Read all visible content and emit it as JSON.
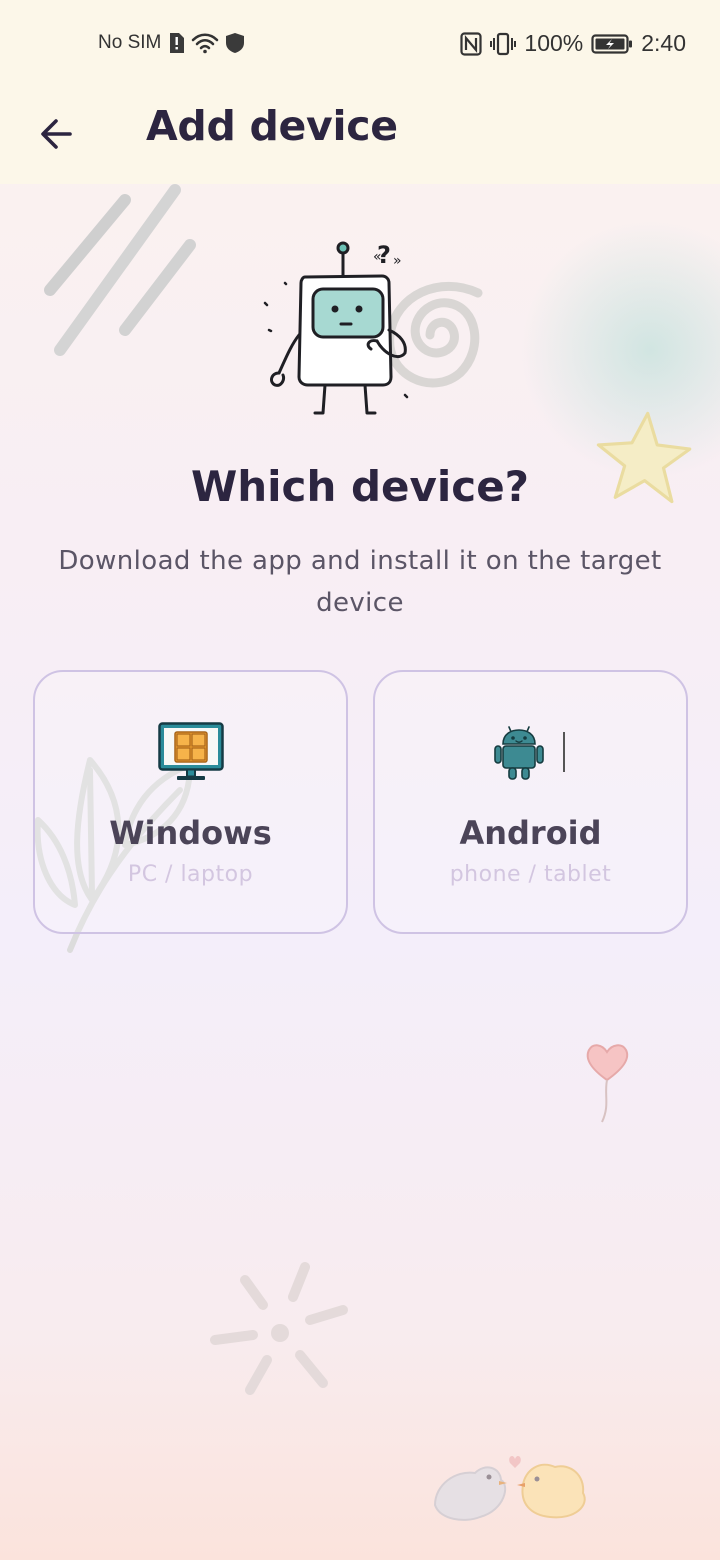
{
  "status_bar": {
    "carrier": "No SIM",
    "battery_percent": "100%",
    "time": "2:40",
    "icons": [
      "sim-alert-icon",
      "wifi-icon",
      "shield-icon",
      "nfc-icon",
      "vibrate-icon",
      "battery-charging-icon"
    ]
  },
  "app_bar": {
    "back_icon": "arrow-left-icon",
    "title": "Add device"
  },
  "main": {
    "heading": "Which device?",
    "subtitle": "Download the app and install it on the target device"
  },
  "devices": [
    {
      "name": "Windows",
      "subtitle": "PC / laptop",
      "icon": "windows-monitor-icon"
    },
    {
      "name": "Android",
      "subtitle": "phone / tablet",
      "icon": "android-robot-icon"
    }
  ],
  "colors": {
    "top_bar_bg": "#fcf7e9",
    "title_text": "#2c2540",
    "card_border": "#cfc3e4",
    "windows_screen": "#2b8c9a",
    "windows_logo": "#f4a532",
    "android_body": "#3d8a92"
  }
}
